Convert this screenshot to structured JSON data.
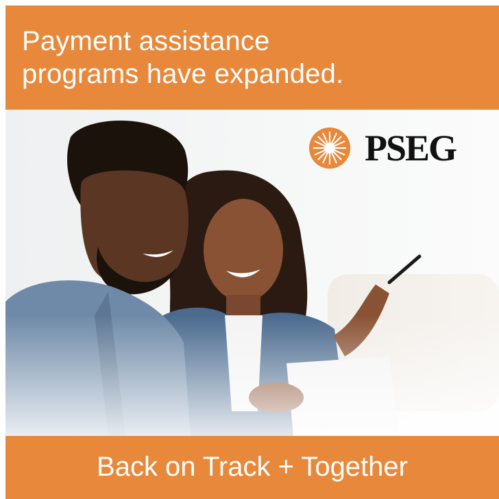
{
  "ad": {
    "headline_line1": "Payment assistance",
    "headline_line2": "programs have expanded.",
    "brand_name": "PSEG",
    "tagline": "Back on Track + Together"
  },
  "colors": {
    "accent_orange": "#E8883A",
    "text_white": "#FFFFFF",
    "logo_black": "#111111"
  },
  "icons": {
    "logo": "sunburst-logo-icon"
  }
}
